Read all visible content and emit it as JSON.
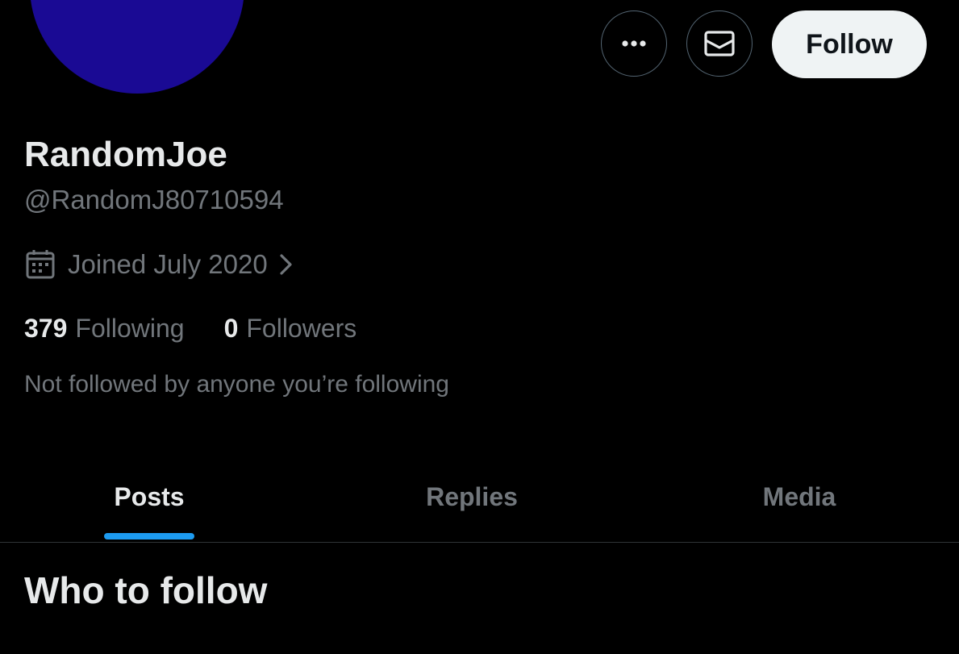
{
  "profile": {
    "display_name": "RandomJoe",
    "handle": "@RandomJ80710594",
    "joined": "Joined July 2020",
    "avatar_color": "#1a0a94"
  },
  "actions": {
    "more_icon": "more-horizontal-icon",
    "message_icon": "envelope-icon",
    "follow_label": "Follow"
  },
  "stats": {
    "following_count": "379",
    "following_label": "Following",
    "followers_count": "0",
    "followers_label": "Followers"
  },
  "not_followed_text": "Not followed by anyone you’re following",
  "tabs": [
    {
      "label": "Posts",
      "active": true
    },
    {
      "label": "Replies",
      "active": false
    },
    {
      "label": "Media",
      "active": false
    }
  ],
  "section_title": "Who to follow",
  "colors": {
    "background": "#000000",
    "primary_text": "#e7e9ea",
    "secondary_text": "#71767b",
    "accent": "#1d9bf0",
    "border": "#2f3336"
  }
}
